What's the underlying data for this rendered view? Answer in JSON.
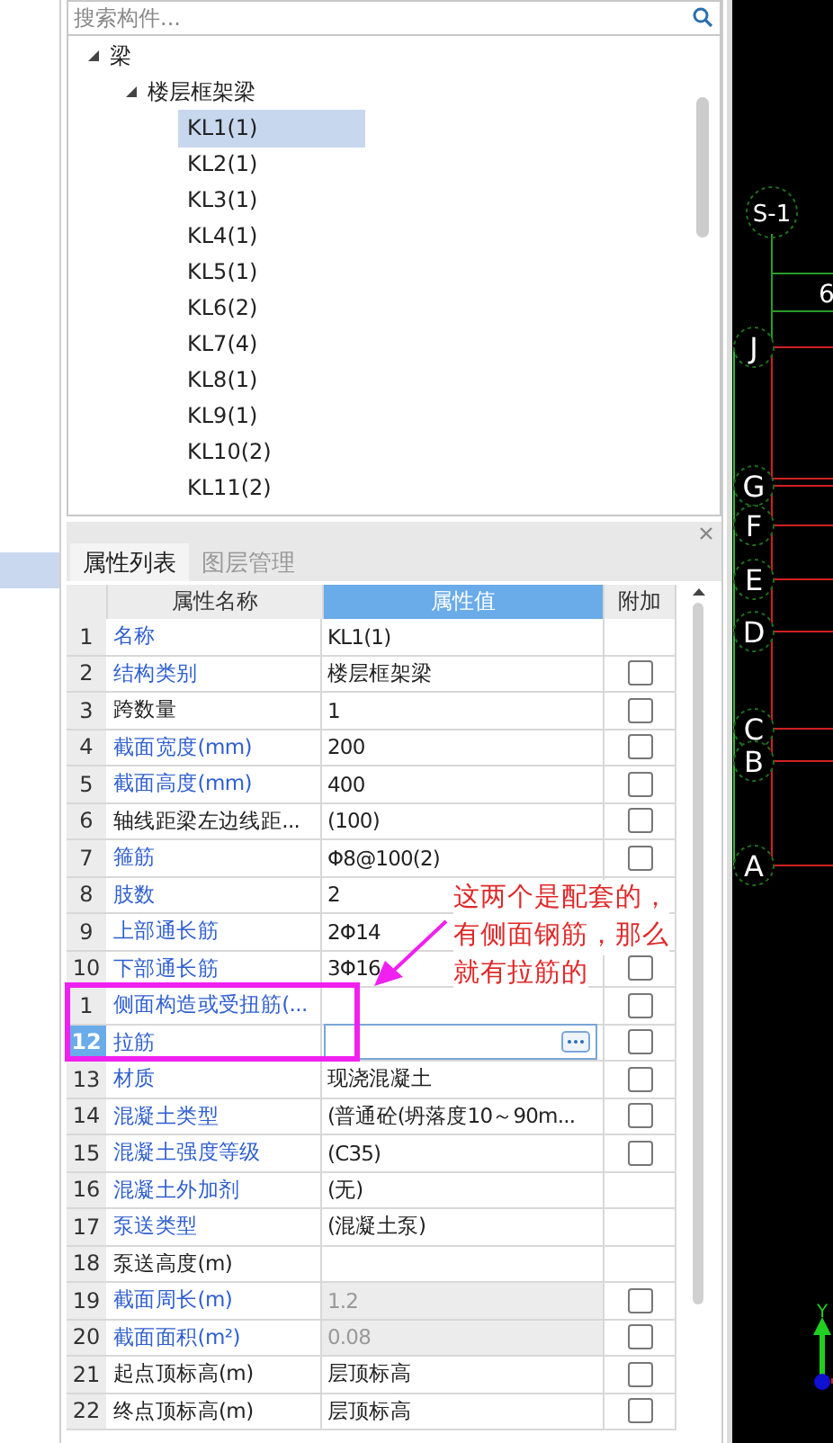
{
  "search": {
    "placeholder": "搜索构件..."
  },
  "tree": [
    {
      "label": "梁",
      "expanded": true,
      "children": [
        {
          "label": "楼层框架梁",
          "expanded": true,
          "children": [
            {
              "label": "KL1(1)",
              "selected": true
            },
            {
              "label": "KL2(1)",
              "selected": false
            },
            {
              "label": "KL3(1)",
              "selected": false
            },
            {
              "label": "KL4(1)",
              "selected": false
            },
            {
              "label": "KL5(1)",
              "selected": false
            },
            {
              "label": "KL6(2)",
              "selected": false
            },
            {
              "label": "KL7(4)",
              "selected": false
            },
            {
              "label": "KL8(1)",
              "selected": false
            },
            {
              "label": "KL9(1)",
              "selected": false
            },
            {
              "label": "KL10(2)",
              "selected": false
            },
            {
              "label": "KL11(2)",
              "selected": false
            }
          ]
        }
      ]
    }
  ],
  "tabs": [
    {
      "label": "属性列表",
      "selected": true
    },
    {
      "label": "图层管理",
      "selected": false
    }
  ],
  "table": {
    "columns": [
      {
        "label": "属性名称",
        "selected": false
      },
      {
        "label": "属性值",
        "selected": true
      },
      {
        "label": "附加",
        "selected": false
      }
    ],
    "rows": [
      {
        "num": "1",
        "name": "名称",
        "value": "KL1(1)",
        "public": true,
        "selected": false,
        "disabled": false,
        "editing": false
      },
      {
        "num": "2",
        "name": "结构类别",
        "value": "楼层框架梁",
        "public": true,
        "selected": false,
        "disabled": false,
        "editing": false,
        "checked": false
      },
      {
        "num": "3",
        "name": "跨数量",
        "value": "1",
        "public": false,
        "selected": false,
        "disabled": false,
        "editing": false,
        "checked": false
      },
      {
        "num": "4",
        "name": "截面宽度(mm)",
        "value": "200",
        "public": true,
        "selected": false,
        "disabled": false,
        "editing": false,
        "checked": false
      },
      {
        "num": "5",
        "name": "截面高度(mm)",
        "value": "400",
        "public": true,
        "selected": false,
        "disabled": false,
        "editing": false,
        "checked": false
      },
      {
        "num": "6",
        "name": "轴线距梁左边线距...",
        "value": "(100)",
        "public": false,
        "selected": false,
        "disabled": false,
        "editing": false,
        "checked": false
      },
      {
        "num": "7",
        "name": "箍筋",
        "value": "Φ8@100(2)",
        "public": true,
        "selected": false,
        "disabled": false,
        "editing": false,
        "checked": false
      },
      {
        "num": "8",
        "name": "肢数",
        "value": "2",
        "public": true,
        "selected": false,
        "disabled": false,
        "editing": false
      },
      {
        "num": "9",
        "name": "上部通长筋",
        "value": "2Φ14",
        "public": true,
        "selected": false,
        "disabled": false,
        "editing": false
      },
      {
        "num": "10",
        "name": "下部通长筋",
        "value": "3Φ16",
        "public": true,
        "selected": false,
        "disabled": false,
        "editing": false,
        "checked": false
      },
      {
        "num": "1",
        "name": "侧面构造或受扭筋(...",
        "value": "",
        "public": true,
        "selected": false,
        "disabled": false,
        "editing": false,
        "checked": false
      },
      {
        "num": "12",
        "name": "拉筋",
        "value": "",
        "public": true,
        "selected": true,
        "disabled": false,
        "editing": true,
        "checked": false
      },
      {
        "num": "13",
        "name": "材质",
        "value": "现浇混凝土",
        "public": true,
        "selected": false,
        "disabled": false,
        "editing": false,
        "checked": false
      },
      {
        "num": "14",
        "name": "混凝土类型",
        "value": "(普通砼(坍落度10～90m...",
        "public": true,
        "selected": false,
        "disabled": false,
        "editing": false,
        "checked": false
      },
      {
        "num": "15",
        "name": "混凝土强度等级",
        "value": "(C35)",
        "public": true,
        "selected": false,
        "disabled": false,
        "editing": false,
        "checked": false
      },
      {
        "num": "16",
        "name": "混凝土外加剂",
        "value": "(无)",
        "public": true,
        "selected": false,
        "disabled": false,
        "editing": false
      },
      {
        "num": "17",
        "name": "泵送类型",
        "value": "(混凝土泵)",
        "public": true,
        "selected": false,
        "disabled": false,
        "editing": false
      },
      {
        "num": "18",
        "name": "泵送高度(m)",
        "value": "",
        "public": false,
        "selected": false,
        "disabled": false,
        "editing": false
      },
      {
        "num": "19",
        "name": "截面周长(m)",
        "value": "1.2",
        "public": true,
        "selected": false,
        "disabled": true,
        "editing": false,
        "checked": false
      },
      {
        "num": "20",
        "name": "截面面积(m²)",
        "value": "0.08",
        "public": true,
        "selected": false,
        "disabled": true,
        "editing": false,
        "checked": false
      },
      {
        "num": "21",
        "name": "起点顶标高(m)",
        "value": "层顶标高",
        "public": false,
        "selected": false,
        "disabled": false,
        "editing": false,
        "checked": false
      },
      {
        "num": "22",
        "name": "终点顶标高(m)",
        "value": "层顶标高",
        "public": false,
        "selected": false,
        "disabled": false,
        "editing": false,
        "checked": false
      }
    ]
  },
  "annotation": {
    "lines": [
      "这两个是配套的，",
      "有侧面钢筋，那么",
      "就有拉筋的"
    ]
  },
  "canvas": {
    "top_label": "S-1",
    "dimension": "6",
    "axes": [
      {
        "label": "J"
      },
      {
        "label": "G"
      },
      {
        "label": "F"
      },
      {
        "label": "E"
      },
      {
        "label": "D"
      },
      {
        "label": "C"
      },
      {
        "label": "B"
      },
      {
        "label": "A"
      }
    ],
    "y_axis": "Y"
  }
}
